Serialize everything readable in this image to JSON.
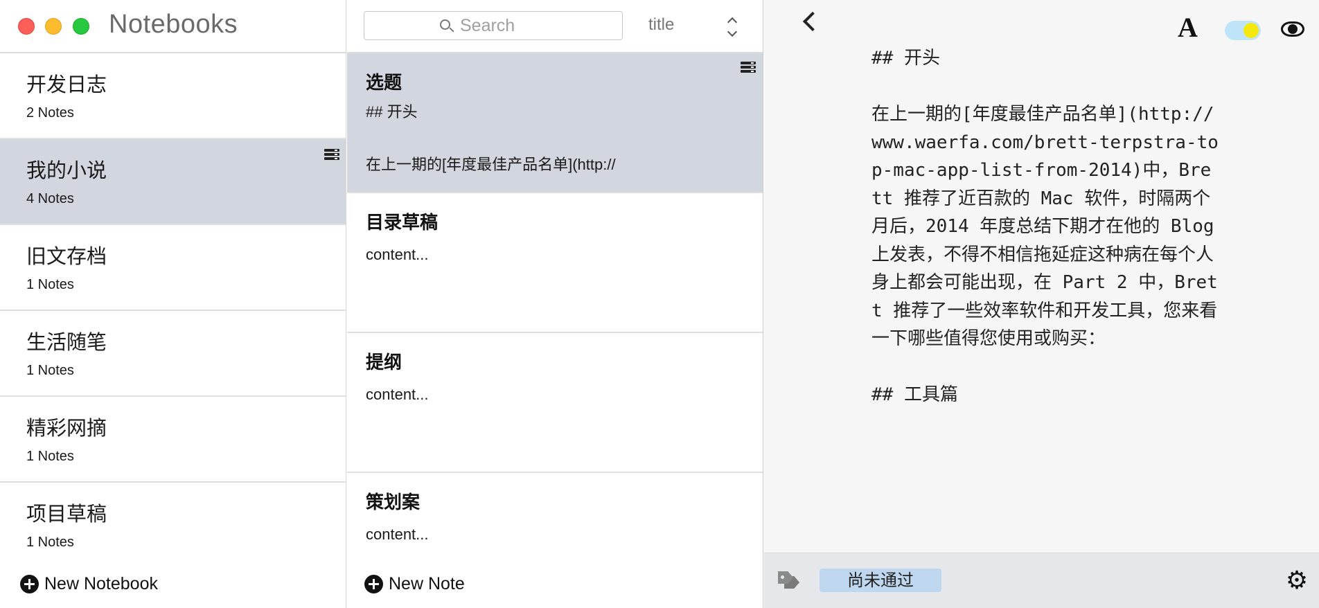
{
  "notebooks_panel": {
    "title": "Notebooks",
    "items": [
      {
        "name": "开发日志",
        "count": "2 Notes"
      },
      {
        "name": "我的小说",
        "count": "4 Notes",
        "selected": true
      },
      {
        "name": "旧文存档",
        "count": "1 Notes"
      },
      {
        "name": "生活随笔",
        "count": "1 Notes"
      },
      {
        "name": "精彩网摘",
        "count": "1 Notes"
      },
      {
        "name": "项目草稿",
        "count": "1 Notes"
      }
    ],
    "new_notebook_label": "New Notebook"
  },
  "notes_panel": {
    "search_placeholder": "Search",
    "sort_label": "title",
    "items": [
      {
        "title": "选题",
        "preview": "## 开头\n\n在上一期的[年度最佳产品名单](http://",
        "selected": true
      },
      {
        "title": "目录草稿",
        "preview": "content..."
      },
      {
        "title": "提纲",
        "preview": "content..."
      },
      {
        "title": "策划案",
        "preview": "content..."
      }
    ],
    "new_note_label": "New Note"
  },
  "editor": {
    "font_icon_glyph": "A",
    "content": "## 开头\n\n在上一期的[年度最佳产品名单](http://www.waerfa.com/brett-terpstra-top-mac-app-list-from-2014)中，Brett 推荐了近百款的 Mac 软件，时隔两个月后，2014 年度总结下期才在他的 Blog 上发表，不得不相信拖延症这种病在每个人身上都会可能出现，在 Part 2 中，Brett 推荐了一些效率软件和开发工具，您来看一下哪些值得您使用或购买：\n\n## 工具篇",
    "tag": "尚未通过",
    "gear_glyph": "⚙"
  },
  "colors": {
    "selection": "#d2d6de",
    "tag_chip": "#bed7ef",
    "toggle_track": "#bfe4f7",
    "toggle_knob": "#f5e80f"
  },
  "icons": [
    "close-icon",
    "minimize-icon",
    "zoom-icon",
    "list-icon",
    "search-icon",
    "sort-chevrons-icon",
    "plus-icon",
    "back-chevron-icon",
    "font-icon",
    "theme-toggle",
    "eye-icon",
    "tag-icon",
    "gear-icon"
  ]
}
